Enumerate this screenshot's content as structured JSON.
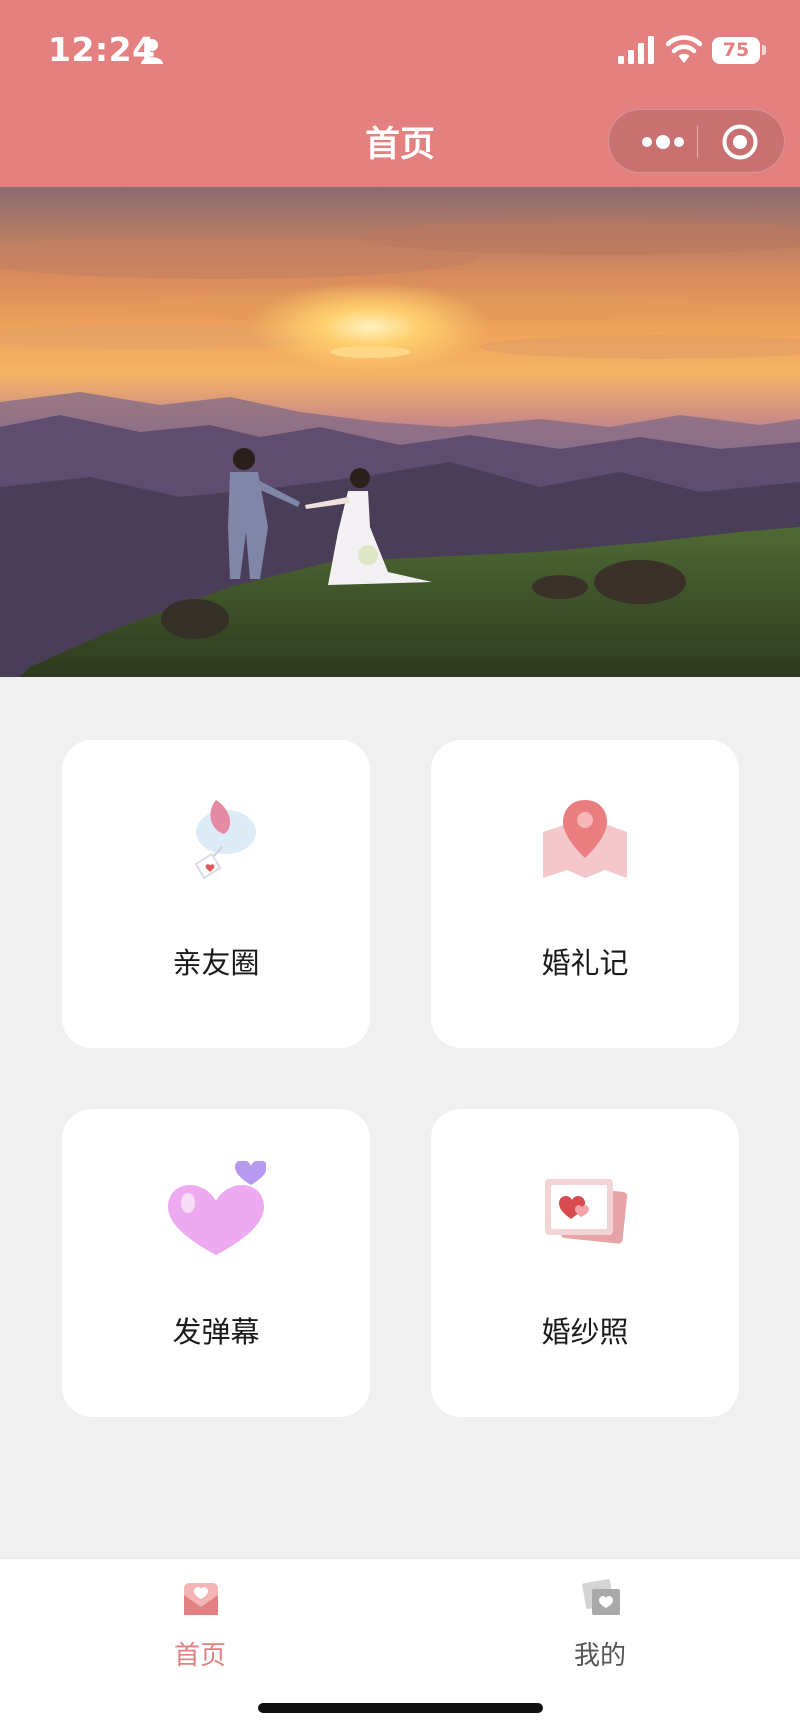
{
  "status_bar": {
    "time": "12:24",
    "battery": "75"
  },
  "header": {
    "title": "首页"
  },
  "grid": {
    "items": [
      {
        "label": "亲友圈",
        "icon": "dove-icon"
      },
      {
        "label": "婚礼记",
        "icon": "map-pin-icon"
      },
      {
        "label": "发弹幕",
        "icon": "heart-bubble-icon"
      },
      {
        "label": "婚纱照",
        "icon": "photo-frame-icon"
      }
    ]
  },
  "tabbar": {
    "items": [
      {
        "label": "首页",
        "icon": "envelope-heart-icon",
        "active": true
      },
      {
        "label": "我的",
        "icon": "photo-heart-icon",
        "active": false
      }
    ]
  },
  "colors": {
    "accent": "#e58081",
    "background": "#f0f0f0",
    "card": "#ffffff"
  }
}
